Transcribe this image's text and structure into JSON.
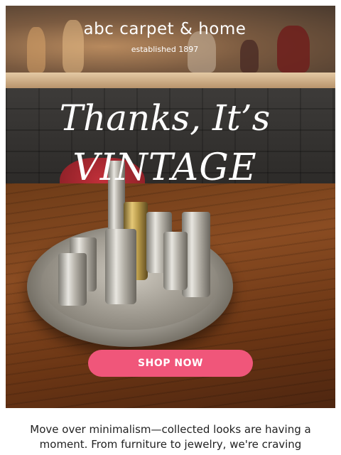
{
  "header": {
    "brand": "abc carpet & home",
    "tagline": "established 1897"
  },
  "hero": {
    "headline_line1": "Thanks, It’s",
    "headline_line2": "VINTAGE",
    "image_alt": "silver and brass candlesticks on a gallery tray atop a wooden table"
  },
  "cta": {
    "label": "SHOP NOW"
  },
  "body": {
    "text": "Move over minimalism—collected looks are having a moment. From furniture to jewelry, we're craving"
  },
  "colors": {
    "cta": "#f0567a",
    "headline": "#ffffff"
  }
}
